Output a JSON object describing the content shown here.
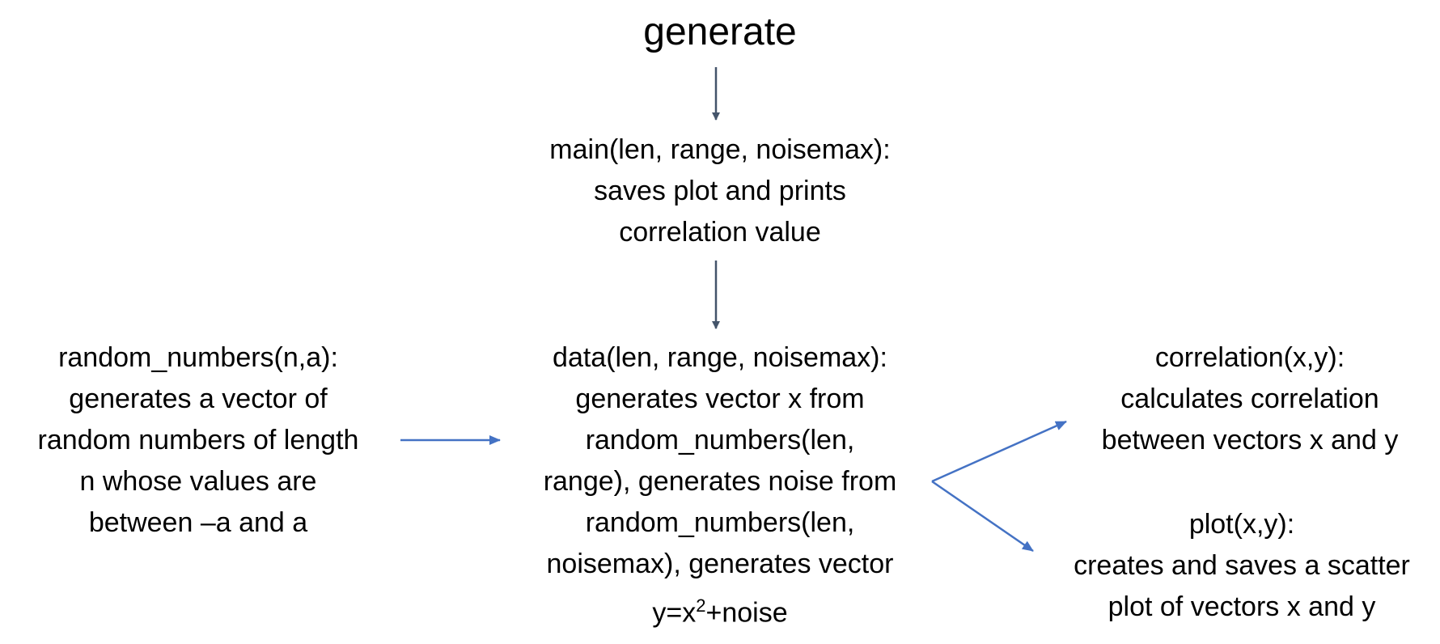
{
  "title": "generate",
  "main_box": {
    "lines": [
      "main(len, range, noisemax):",
      "saves plot and prints",
      "correlation value"
    ]
  },
  "random_numbers_box": {
    "lines": [
      "random_numbers(n,a):",
      "generates a vector of",
      "random numbers of length",
      "n whose values are",
      "between –a and a"
    ]
  },
  "data_box": {
    "lines": [
      "data(len, range, noisemax):",
      "generates vector x from",
      "random_numbers(len,",
      "range), generates noise from",
      "random_numbers(len,",
      "noisemax), generates vector"
    ],
    "last_line": {
      "prefix": "y=x",
      "superscript": "2",
      "suffix": "+noise"
    }
  },
  "correlation_box": {
    "lines": [
      "correlation(x,y):",
      "calculates correlation",
      "between vectors x and y"
    ]
  },
  "plot_box": {
    "lines": [
      "plot(x,y):",
      "creates and saves a scatter",
      "plot of vectors x and y"
    ]
  },
  "colors": {
    "dark_arrow": "#44546a",
    "blue_arrow": "#4472c4",
    "text": "#000000"
  }
}
